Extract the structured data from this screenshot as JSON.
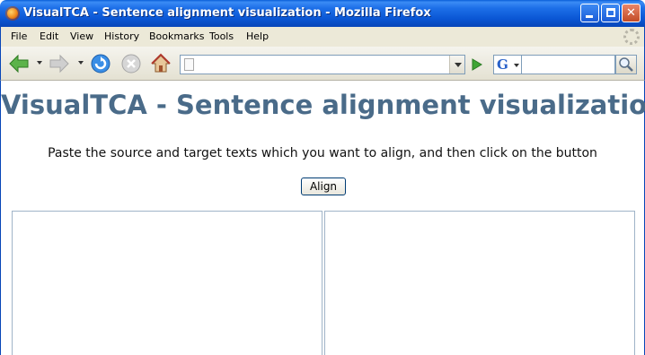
{
  "window": {
    "title": "VisualTCA - Sentence alignment visualization - Mozilla Firefox"
  },
  "menu": {
    "items": [
      "File",
      "Edit",
      "View",
      "History",
      "Bookmarks",
      "Tools",
      "Help"
    ]
  },
  "toolbar": {
    "url_value": "",
    "search_value": "",
    "search_engine": "G"
  },
  "page": {
    "title": "VisualTCA - Sentence alignment visualization",
    "instructions": "Paste the source and target texts which you want to align, and then click on the button",
    "align_label": "Align",
    "source_text": "",
    "target_text": ""
  },
  "colors": {
    "title_color": "#4a6b89",
    "titlebar_blue": "#0a56d4",
    "chrome_bg": "#ece9d8"
  }
}
